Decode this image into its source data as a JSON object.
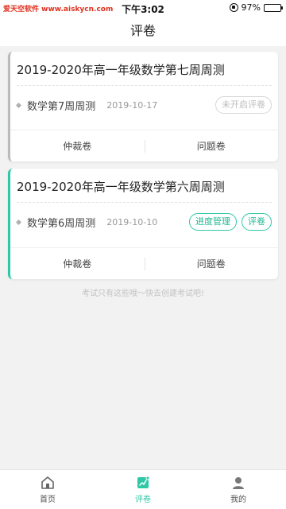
{
  "status_bar": {
    "watermark": "爱天空软件 www.aiskycn.com",
    "time": "下午3:02",
    "battery": "97%"
  },
  "header": {
    "title": "评卷"
  },
  "exams": [
    {
      "title": "2019-2020年高一年级数学第七周周测",
      "name": "数学第7周周测",
      "date": "2019-10-17",
      "actions": [
        "未开启评卷"
      ],
      "footer": [
        "仲裁卷",
        "问题卷"
      ],
      "accent": "#bbbbbb"
    },
    {
      "title": "2019-2020年高一年级数学第六周周测",
      "name": "数学第6周周测",
      "date": "2019-10-10",
      "actions": [
        "进度管理",
        "评卷"
      ],
      "footer": [
        "仲裁卷",
        "问题卷"
      ],
      "accent": "#2ec8a6"
    }
  ],
  "hint": "考试只有这些哦～快去创建考试吧!",
  "tabbar": {
    "items": [
      {
        "label": "首页",
        "icon": "home-icon"
      },
      {
        "label": "评卷",
        "icon": "grade-icon"
      },
      {
        "label": "我的",
        "icon": "user-icon"
      }
    ],
    "active": "评卷"
  },
  "colors": {
    "accent": "#2ec8a6",
    "watermark": "#e0301e"
  }
}
